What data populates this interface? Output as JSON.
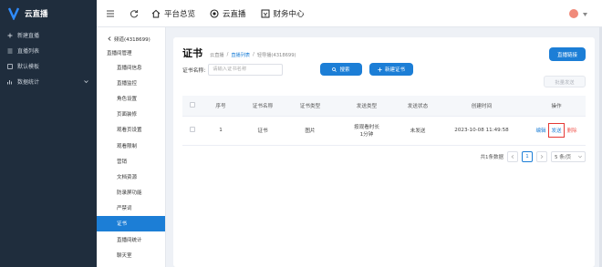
{
  "sidebar": {
    "brand": "云直播",
    "items": [
      {
        "label": "新建直播",
        "icon": "plus-icon"
      },
      {
        "label": "直播列表",
        "icon": "list-icon"
      },
      {
        "label": "默认模板",
        "icon": "template-icon"
      },
      {
        "label": "数据统计",
        "icon": "chart-icon"
      }
    ]
  },
  "topbar": {
    "nav": [
      {
        "label": "平台总览",
        "icon": "home-icon"
      },
      {
        "label": "云直播",
        "icon": "live-icon"
      },
      {
        "label": "财务中心",
        "icon": "finance-icon"
      }
    ]
  },
  "submenu": {
    "back": "频道(4318699)",
    "group": "直播间管理",
    "items": [
      "直播间信息",
      "直播监控",
      "角色设置",
      "页面装修",
      "观看页设置",
      "观看限制",
      "营销",
      "文档资源",
      "防录屏功能",
      "严禁词",
      "证书",
      "直播间统计",
      "聊天室"
    ],
    "active_index": 10
  },
  "main": {
    "title": "证书",
    "breadcrumbs": [
      "云直播",
      "直播列表",
      "轻导播(4318699)"
    ],
    "live_link_button": "直播链接",
    "filter_label": "证书名称:",
    "filter_placeholder": "请输入证书名称",
    "search_button": "搜索",
    "new_button": "新建证书",
    "batch_send_button": "批量发送",
    "table": {
      "headers": [
        "序号",
        "证书名称",
        "证书类型",
        "发送类型",
        "发送状态",
        "创建时间",
        "操作"
      ],
      "rows": [
        {
          "index": "1",
          "name": "证书",
          "type": "图片",
          "send_type_line1": "按观看时长",
          "send_type_line2": "1分钟",
          "status": "未发送",
          "created": "2023-10-08 11:49:58",
          "ops": [
            "编辑",
            "发送",
            "删除"
          ]
        }
      ]
    },
    "pagination": {
      "total": "共1条数据",
      "current": "1",
      "page_size": "5 条/页"
    }
  }
}
